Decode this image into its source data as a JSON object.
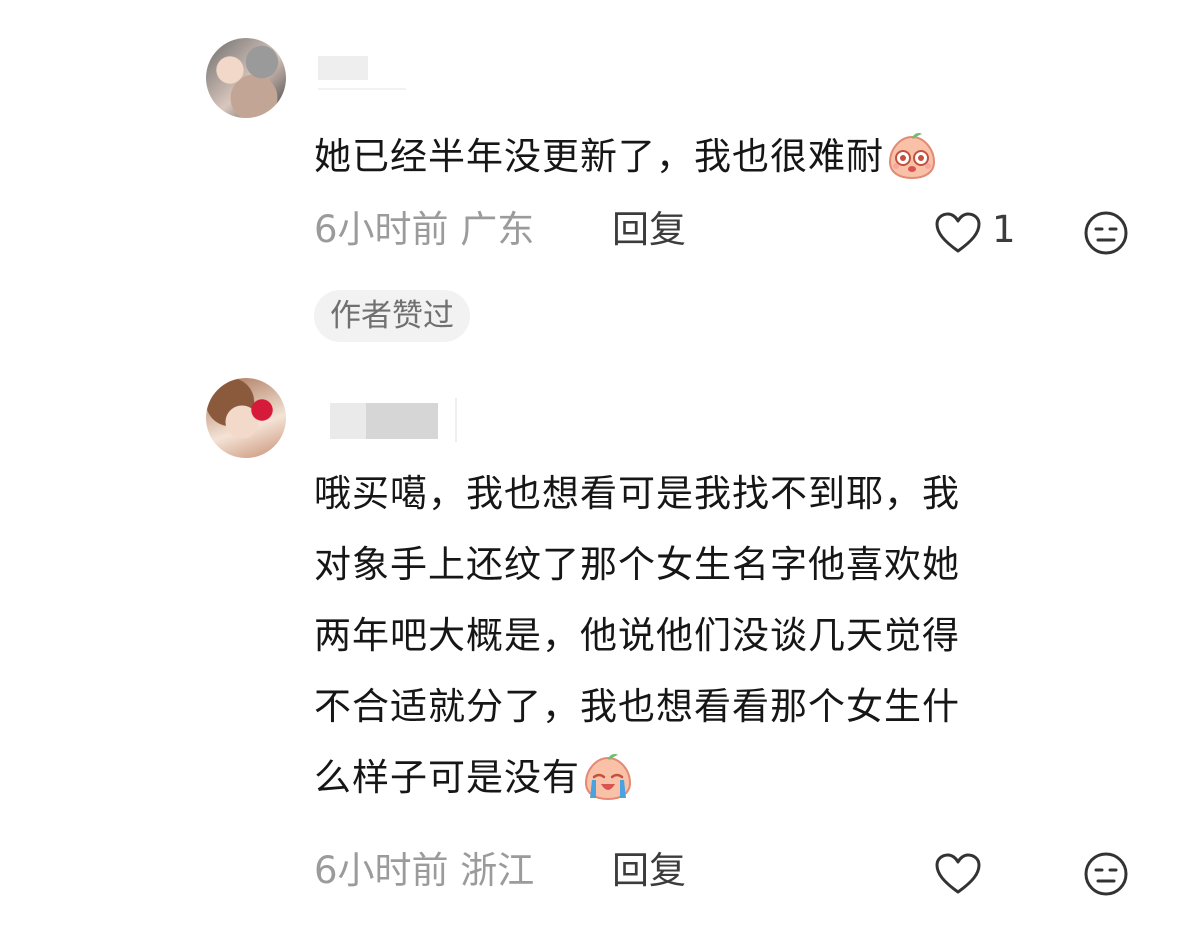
{
  "comments": [
    {
      "text": "她已经半年没更新了，我也很难耐",
      "emoji": "peach-face-happy-emoji",
      "time_location": "6小时前 广东",
      "reply_label": "回复",
      "like_count": "1",
      "badge": "作者赞过",
      "icons": {
        "like": "heart-outline-icon",
        "dislike": "meh-face-icon"
      }
    },
    {
      "text_lines": [
        "哦买噶，我也想看可是我找不到耶，我",
        "对象手上还纹了那个女生名字他喜欢她",
        "两年吧大概是，他说他们没谈几天觉得",
        "不合适就分了，我也想看看那个女生什",
        "么样子可是没有"
      ],
      "emoji": "peach-face-crying-emoji",
      "time_location": "6小时前 浙江",
      "reply_label": "回复",
      "icons": {
        "like": "heart-outline-icon",
        "dislike": "meh-face-icon"
      }
    }
  ],
  "colors": {
    "text": "#161616",
    "meta_gray": "#9b9b9b",
    "badge_bg": "#f2f2f2",
    "badge_text": "#707070"
  }
}
